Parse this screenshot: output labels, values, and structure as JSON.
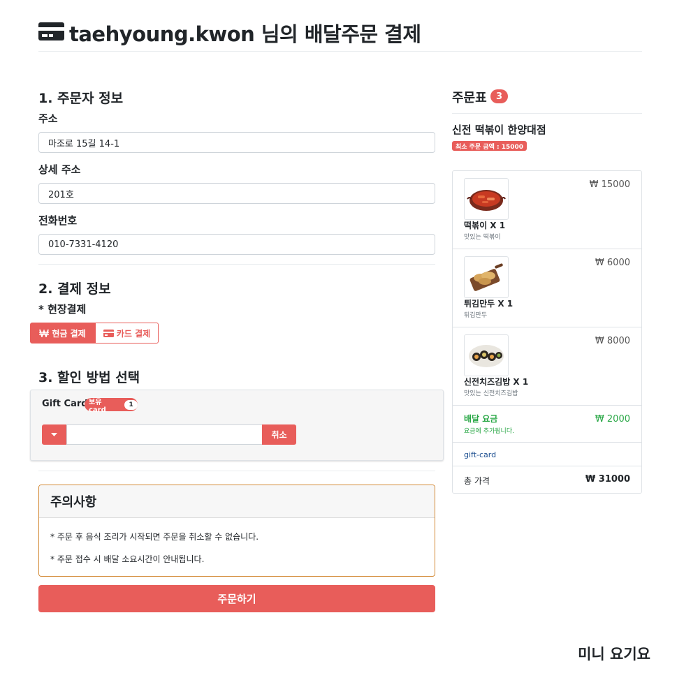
{
  "header": {
    "icon": "credit-card-icon",
    "title": "taehyoung.kwon 님의 배달주문 결제"
  },
  "orderer": {
    "section_title": "1. 주문자 정보",
    "address_label": "주소",
    "address_value": "마조로 15길 14-1",
    "detail_label": "상세 주소",
    "detail_value": "201호",
    "phone_label": "전화번호",
    "phone_value": "010-7331-4120"
  },
  "payment": {
    "section_title": "2. 결제 정보",
    "method_label": "* 현장결제",
    "cash_label": "현금 결제",
    "card_label": "카드 결제",
    "cash_icon": "won-icon",
    "card_icon": "credit-card-icon",
    "active": "cash"
  },
  "discount": {
    "section_title": "3. 할인 방법 선택",
    "gift_card_label": "Gift Card",
    "badge_label": "보유 card",
    "badge_count": "1",
    "input_value": "",
    "cancel_label": "취소"
  },
  "notice": {
    "title": "주의사항",
    "lines": [
      "* 주문 후 음식 조리가 시작되면 주문을 취소할 수 없습니다.",
      "* 주문 접수 시 배달 소요시간이 안내됩니다."
    ]
  },
  "submit_label": "주문하기",
  "cart": {
    "title": "주문표",
    "count": "3",
    "store_name": "신전 떡볶이 한양대점",
    "min_order": "최소 주문 금액 : 15000",
    "items": [
      {
        "name": "떡볶이 X 1",
        "desc": "맛있는 떡볶이",
        "price": "₩ 15000",
        "image": "tteokbokki-image"
      },
      {
        "name": "튀김만두 X 1",
        "desc": "튀김만두",
        "price": "₩ 6000",
        "image": "fried-dumpling-image"
      },
      {
        "name": "신전치즈김밥 X 1",
        "desc": "맛있는 신전치즈김밥",
        "price": "₩ 8000",
        "image": "cheese-gimbap-image"
      }
    ],
    "delivery_label": "배달 요금",
    "delivery_sub": "요금에 추가됩니다.",
    "delivery_price": "₩ 2000",
    "gift_card_row": "gift-card",
    "total_label": "총 가격",
    "total_value": "₩ 31000"
  },
  "footer_brand": "미니 요기요",
  "colors": {
    "accent": "#e85d5a",
    "success": "#28a745",
    "notice_border": "#d38a36",
    "link": "#1a4d8f"
  }
}
